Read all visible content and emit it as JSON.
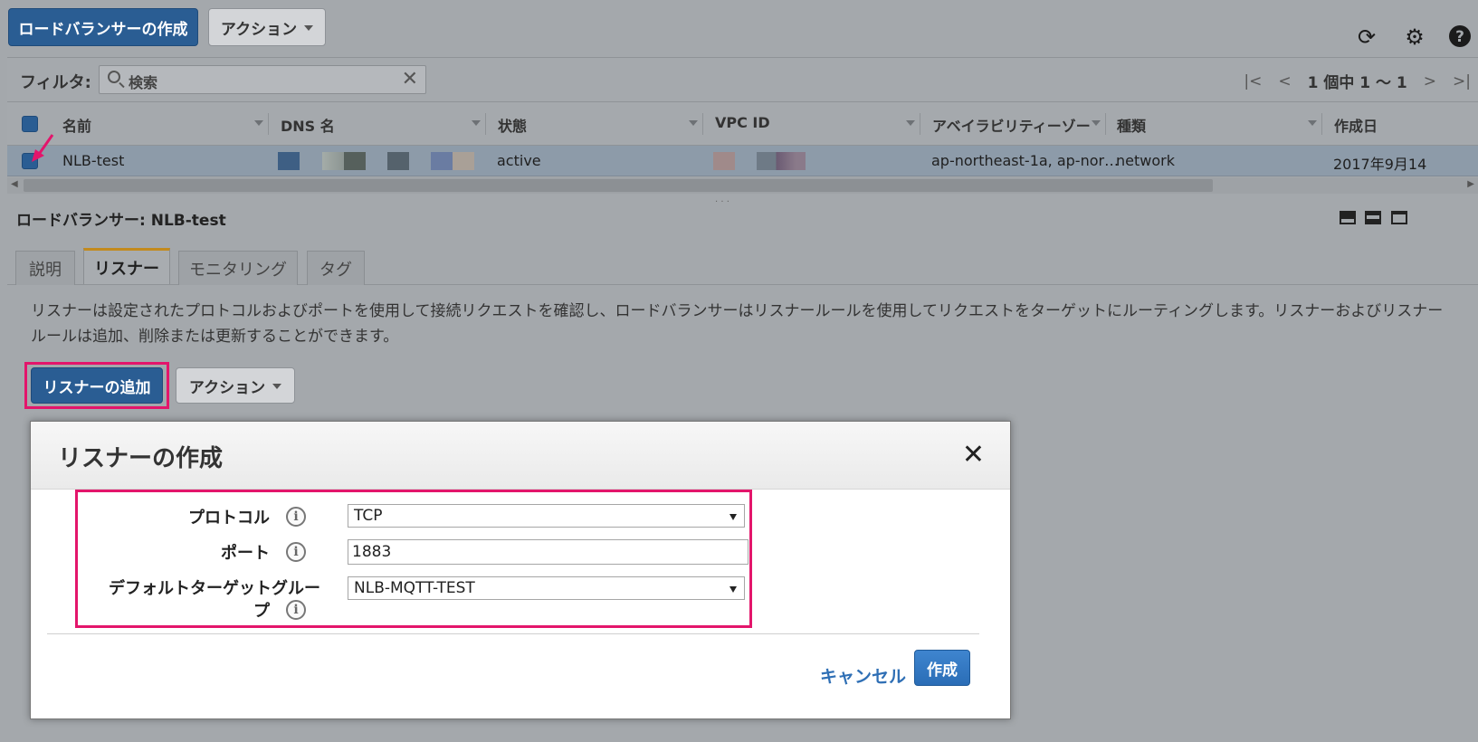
{
  "toolbar": {
    "create_lb_label": "ロードバランサーの作成",
    "actions_label": "アクション"
  },
  "top_icons": [
    "refresh-icon",
    "gear-icon",
    "help-icon"
  ],
  "filter": {
    "label": "フィルタ:",
    "search_placeholder": "検索",
    "pagination_text": "1 個中 1 〜 1"
  },
  "table": {
    "columns": [
      "名前",
      "DNS 名",
      "状態",
      "VPC ID",
      "アベイラビリティーゾー",
      "種類",
      "作成日"
    ],
    "rows": [
      {
        "name": "NLB-test",
        "state": "active",
        "availability_zones": "ap-northeast-1a, ap-nor…",
        "type": "network",
        "created": "2017年9月14"
      }
    ]
  },
  "detail": {
    "title": "ロードバランサー: NLB-test",
    "tabs": [
      "説明",
      "リスナー",
      "モニタリング",
      "タグ"
    ],
    "active_tab": "リスナー",
    "description": "リスナーは設定されたプロトコルおよびポートを使用して接続リクエストを確認し、ロードバランサーはリスナールールを使用してリクエストをターゲットにルーティングします。リスナーおよびリスナールールは追加、削除または更新することができます。",
    "add_listener_label": "リスナーの追加",
    "actions_label": "アクション"
  },
  "modal": {
    "title": "リスナーの作成",
    "protocol_label": "プロトコル",
    "protocol_value": "TCP",
    "port_label": "ポート",
    "port_value": "1883",
    "target_group_label_line1": "デフォルトターゲットグルー",
    "target_group_label_line2": "プ",
    "target_group_value": "NLB-MQTT-TEST",
    "cancel_label": "キャンセル",
    "create_label": "作成"
  },
  "colors": {
    "primary": "#2a5d93",
    "highlight": "#e3156b",
    "tab_accent": "#c38a1d",
    "link": "#2f6fb5"
  }
}
